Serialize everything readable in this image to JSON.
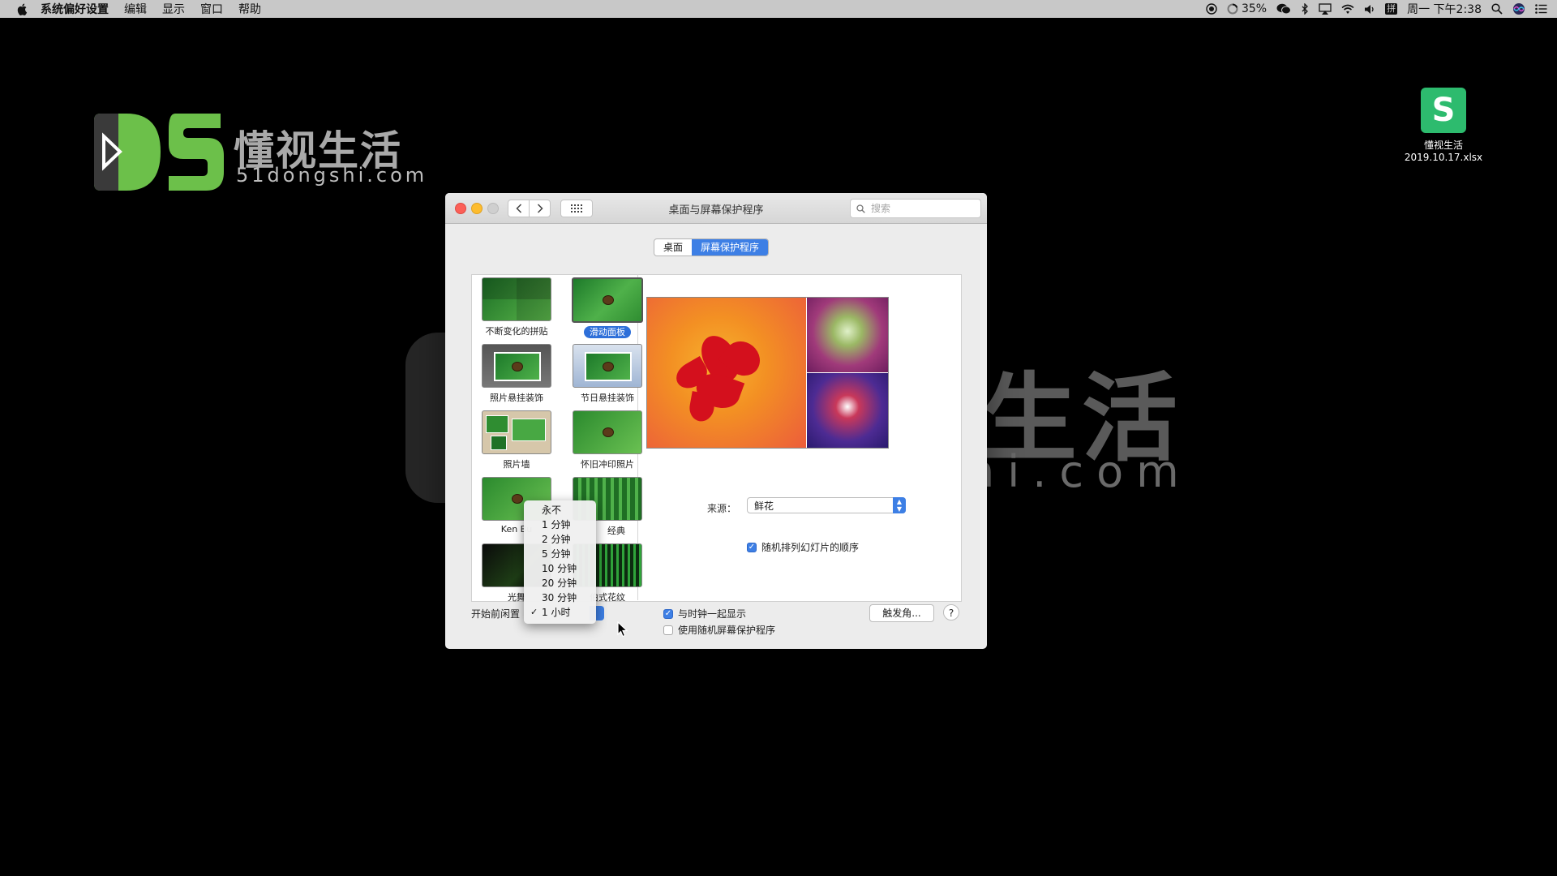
{
  "menubar": {
    "app_name": "系统偏好设置",
    "items": [
      "编辑",
      "显示",
      "窗口",
      "帮助"
    ],
    "battery": "35%",
    "clock": "周一 下午2:38",
    "input_method": "拼"
  },
  "background": {
    "logo_text_cn": "懂视生活",
    "logo_url": "51dongshi.com",
    "ghost_text_cn": "生活",
    "ghost_url": "hi.com"
  },
  "desktop_file": {
    "icon_letter": "S",
    "name_line1": "懂视生活",
    "name_line2": "2019.10.17.xlsx"
  },
  "window": {
    "title": "桌面与屏幕保护程序",
    "search_placeholder": "搜索",
    "tabs": [
      "桌面",
      "屏幕保护程序"
    ],
    "active_tab": "屏幕保护程序",
    "screensavers": [
      {
        "label": "不断变化的拼贴",
        "selected": false
      },
      {
        "label": "滑动面板",
        "selected": true
      },
      {
        "label": "照片悬挂装饰",
        "selected": false
      },
      {
        "label": "节日悬挂装饰",
        "selected": false
      },
      {
        "label": "照片墙",
        "selected": false
      },
      {
        "label": "怀旧冲印照片",
        "selected": false
      },
      {
        "label": "Ken Bu",
        "selected": false
      },
      {
        "label": "经典",
        "selected": false
      },
      {
        "label": "光舞",
        "selected": false
      },
      {
        "label": "伯式花纹",
        "selected": false
      }
    ],
    "source_label": "来源：",
    "source_value": "鲜花",
    "shuffle_label": "随机排列幻灯片的顺序",
    "shuffle_checked": true,
    "idle_label": "开始前闲置",
    "show_clock_label": "与时钟一起显示",
    "show_clock_checked": true,
    "random_saver_label": "使用随机屏幕保护程序",
    "random_saver_checked": false,
    "hot_corners_label": "触发角...",
    "help_label": "?"
  },
  "idle_menu": {
    "options": [
      "永不",
      "1 分钟",
      "2 分钟",
      "5 分钟",
      "10 分钟",
      "20 分钟",
      "30 分钟",
      "1 小时"
    ],
    "selected": "1 小时",
    "check_mark": "✓"
  },
  "colors": {
    "accent": "#3d7fe5",
    "desktop": "#000000",
    "logo_green": "#6cc04a"
  }
}
